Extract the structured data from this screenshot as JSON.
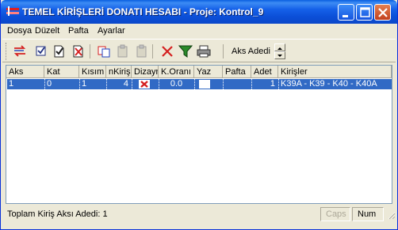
{
  "window": {
    "title": "TEMEL KİRİŞLERİ DONATI HESABI - Proje: Kontrol_9"
  },
  "menu": [
    {
      "label": "Dosya",
      "accel": "D"
    },
    {
      "label": "Düzelt",
      "accel": "D"
    },
    {
      "label": "Pafta",
      "accel": "P"
    },
    {
      "label": "Ayarlar",
      "accel": "A"
    }
  ],
  "toolbar": {
    "icons": [
      "swap-icon",
      "check-icon",
      "document-check-icon",
      "document-delete-icon",
      "copy-icon",
      "paste-icon-disabled",
      "paste-icon-disabled-2",
      "delete-icon",
      "filter-icon",
      "print-icon"
    ],
    "aks_label": "Aks Adedi"
  },
  "table": {
    "columns": [
      "Aks",
      "Kat",
      "Kısım",
      "nKiriş",
      "Dizayn",
      "K.Oranı",
      "Yaz",
      "Pafta",
      "Adet",
      "Kirişler"
    ],
    "rows": [
      {
        "aks": "1",
        "kat": "0",
        "kisim": "1",
        "nkiris": "4",
        "dizayn": "x",
        "koran": "0.0",
        "yaz": "",
        "pafta": "",
        "adet": "1",
        "kirisler": "K39A - K39 - K40 - K40A"
      }
    ],
    "selected_color": "#316ac5"
  },
  "status": {
    "text": "Toplam Kiriş Aksı Adedi: 1",
    "caps": "Caps",
    "num": "Num"
  },
  "colors": {
    "titlebar": "#0b4fd8",
    "face": "#ece9d8",
    "selection": "#316ac5",
    "close_button": "#c2401e",
    "delete_icon": "#d42020"
  }
}
